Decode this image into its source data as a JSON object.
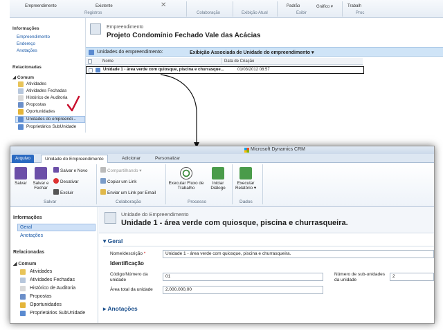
{
  "top": {
    "ribbon": {
      "items": [
        "Empreendimento",
        "Existente",
        "Padrão",
        "Gráfico",
        "Trabalh"
      ],
      "groups": [
        "Registros",
        "Colaboração",
        "Exibição Atual",
        "Exibir",
        "Proc"
      ]
    },
    "nav": {
      "info_header": "Informações",
      "info_items": [
        "Empreendimento",
        "Endereço",
        "Anotações"
      ],
      "related_header": "Relacionadas",
      "common_header": "Comum",
      "common_items": [
        "Atividades",
        "Atividades Fechadas",
        "Histórico de Auditoria",
        "Propostas",
        "Oportunidades",
        "Unidades do empreendi...",
        "Proprietários SubUnidade"
      ]
    },
    "record": {
      "type": "Empreendimento",
      "title": "Projeto Condomínio Fechado Vale das Acácias"
    },
    "associated": {
      "label": "Unidades do empreendimento:",
      "view": "Exibição Associada de Unidade do empreendimento",
      "columns": [
        "Nome",
        "Data de Criação"
      ],
      "row": {
        "name": "Unidade 1 - área verde com quiosque, piscina e churrasque...",
        "date": "01/03/2012 08:57"
      }
    }
  },
  "bottom": {
    "product": "Microsoft Dynamics CRM",
    "tabs": [
      "Arquivo",
      "Unidade do Empreendimento",
      "Adicionar",
      "Personalizar"
    ],
    "ribbon": {
      "save": "Salvar",
      "save_close": "Salvar e Fechar",
      "save_new": "Salvar e Novo",
      "deactivate": "Desativar",
      "delete": "Excluir",
      "share": "Compartilhando",
      "copy_link": "Copiar um Link",
      "email_link": "Enviar um Link por Email",
      "run_workflow": "Executar Fluxo de Trabalho",
      "start_dialog": "Iniciar Diálogo",
      "run_report": "Executar Relatório",
      "groups": [
        "Salvar",
        "Colaboração",
        "Processo",
        "Dados"
      ]
    },
    "nav": {
      "info_header": "Informações",
      "info_items": [
        "Geral",
        "Anotações"
      ],
      "related_header": "Relacionadas",
      "common_header": "Comum",
      "common_items": [
        "Atividades",
        "Atividades Fechadas",
        "Histórico de Auditoria",
        "Propostas",
        "Oportunidades",
        "Proprietários SubUnidade"
      ]
    },
    "form": {
      "type": "Unidade do Empreendimento",
      "title": "Unidade 1 - área verde com quiosque, piscina e churrasqueira.",
      "section_general": "Geral",
      "name_label": "Nome/descrição",
      "name_value": "Unidade 1 - área verde com quiosque, piscina e churrasqueira.",
      "subsection": "Identificação",
      "code_label": "Código/Número da unidade",
      "code_value": "01",
      "area_label": "Área total da unidade",
      "area_value": "2.000.000,00",
      "subunits_label": "Número de sub-unidades da unidade",
      "subunits_value": "2",
      "section_notes": "Anotações"
    }
  },
  "colors": {
    "accent": "#2a6ac1",
    "selection": "#cfe1f7",
    "section_heading": "#1b4f8c",
    "annotation_check": "#c8102e"
  }
}
